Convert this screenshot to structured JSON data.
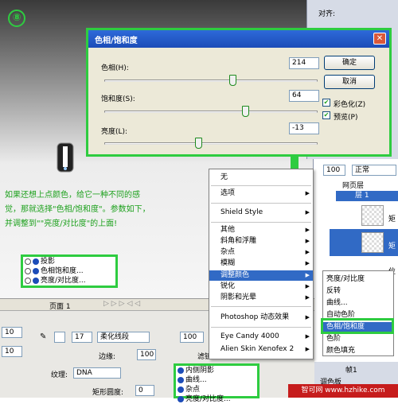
{
  "step": {
    "number": "⑧"
  },
  "dialog": {
    "title": "色相/饱和度",
    "hue": {
      "label": "色相(H):",
      "value": "214",
      "level": 0.6
    },
    "saturation": {
      "label": "饱和度(S):",
      "value": "64",
      "level": 0.66
    },
    "lightness": {
      "label": "亮度(L):",
      "value": "-13",
      "level": 0.44
    },
    "ok_label": "确定",
    "cancel_label": "取消",
    "colorize_label": "彩色化(Z)",
    "preview_label": "预览(P)"
  },
  "note": {
    "line1": "如果还想上点颜色，给它一种不同的感",
    "line2": "觉，那就选择\"色相/饱和度\"。参数如下，",
    "line3": "并调整到\"\"亮度/对比度\"的上面!"
  },
  "mini_layers": [
    "投影",
    "色相饱和度...",
    "亮度/对比度..."
  ],
  "right_panel": {
    "align_label": "对齐:"
  },
  "layers": {
    "opacity": "100",
    "blend": "正常",
    "items": [
      "网页层",
      "层 1",
      "矩",
      "矩",
      "位"
    ]
  },
  "context_menu": {
    "items": [
      "无",
      "选项",
      "Shield Style",
      "其他",
      "斜角和浮雕",
      "杂点",
      "模糊",
      "调整颜色",
      "锐化",
      "阴影和光晕",
      "Photoshop 动态效果",
      "Eye Candy 4000",
      "Alien Skin Xenofex 2"
    ],
    "submenu": [
      "亮度/对比度",
      "反转",
      "曲线...",
      "自动色阶",
      "色相/饱和度",
      "色阶",
      "颜色填充"
    ]
  },
  "pages_bar": {
    "label": "页面 1"
  },
  "props": {
    "stroke_size": "17",
    "stroke_style": "柔化线段",
    "edge_label": "边缘:",
    "edge_value": "100",
    "filter_label": "滤镜:",
    "texture_label": "纹理:",
    "texture_value": "DNA",
    "roundness_label": "矩形圆度:",
    "roundness_value": "0",
    "field_10": "10",
    "opacity_100": "100",
    "filters": [
      "内侧阴影",
      "曲线...",
      "杂点",
      "亮度/对比度..."
    ]
  },
  "frame_label": "帧1",
  "adjust_label": "调色板",
  "watermark": "智可网 www.hzhike.com"
}
